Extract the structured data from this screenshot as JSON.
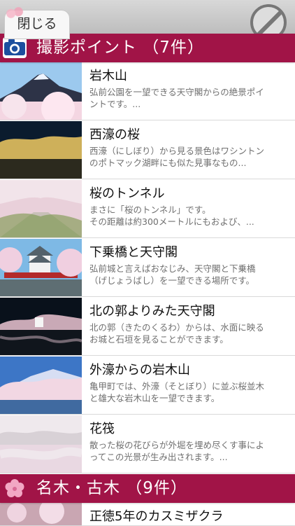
{
  "top": {
    "close_label": "閉じる"
  },
  "section1": {
    "title": "撮影ポイント （7件）"
  },
  "items": [
    {
      "title": "岩木山",
      "desc": "弘前公園を一望できる天守閣からの絶景ポイントです。..."
    },
    {
      "title": "西濠の桜",
      "desc": "西濠（にしぼり）から見る景色はワシントンのポトマック湖畔にも似た見事なもの..."
    },
    {
      "title": "桜のトンネル",
      "desc": "まさに「桜のトンネル」です。\nその距離は約300メートルにもおよび、..."
    },
    {
      "title": "下乗橋と天守閣",
      "desc": "弘前城と言えばおなじみ、天守閣と下乗橋（げじょうばし）を一望できる場所です。"
    },
    {
      "title": "北の郭よりみた天守閣",
      "desc": "北の郭（きたのくるわ）からは、水面に映るお城と石垣を見ることができます。"
    },
    {
      "title": "外濠からの岩木山",
      "desc": "亀甲町では、外濠（そとぼり）に並ぶ桜並木と雄大な岩木山を一望できます。"
    },
    {
      "title": "花筏",
      "desc": "散った桜の花びらが外堀を埋め尽くす事によってこの光景が生み出されます。..."
    }
  ],
  "section2": {
    "title": "名木・古木 （9件）"
  },
  "last_item": {
    "title": "正徳5年のカスミザクラ"
  }
}
